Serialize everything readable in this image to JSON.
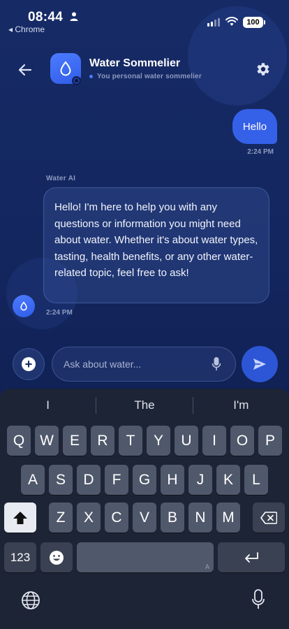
{
  "status_bar": {
    "time": "08:44",
    "back_app": "◂ Chrome",
    "battery": "100"
  },
  "header": {
    "title": "Water Sommelier",
    "subtitle": "You personal water sommelier"
  },
  "messages": {
    "user": {
      "text": "Hello",
      "time": "2:24 PM"
    },
    "ai": {
      "sender": "Water AI",
      "text": "Hello! I'm here to help you with any questions or information you might need about water. Whether it's about water types, tasting, health benefits, or any other water-related topic, feel free to ask!",
      "time": "2:24 PM"
    }
  },
  "composer": {
    "add_label": "+",
    "placeholder": "Ask about water..."
  },
  "keyboard": {
    "suggestions": [
      "I",
      "The",
      "I'm"
    ],
    "row1": [
      "Q",
      "W",
      "E",
      "R",
      "T",
      "Y",
      "U",
      "I",
      "O",
      "P"
    ],
    "row2": [
      "A",
      "S",
      "D",
      "F",
      "G",
      "H",
      "J",
      "K",
      "L"
    ],
    "row3": [
      "Z",
      "X",
      "C",
      "V",
      "B",
      "N",
      "M"
    ],
    "numbers_key": "123",
    "space_hint": "A"
  },
  "colors": {
    "accent": "#3560e8",
    "background": "#13265e",
    "muted_text": "#8e9ac0"
  },
  "icons": {
    "back": "arrow-left-icon",
    "settings": "gear-icon",
    "drop": "water-drop-icon",
    "mic": "microphone-icon",
    "send": "send-icon",
    "globe": "globe-icon"
  }
}
